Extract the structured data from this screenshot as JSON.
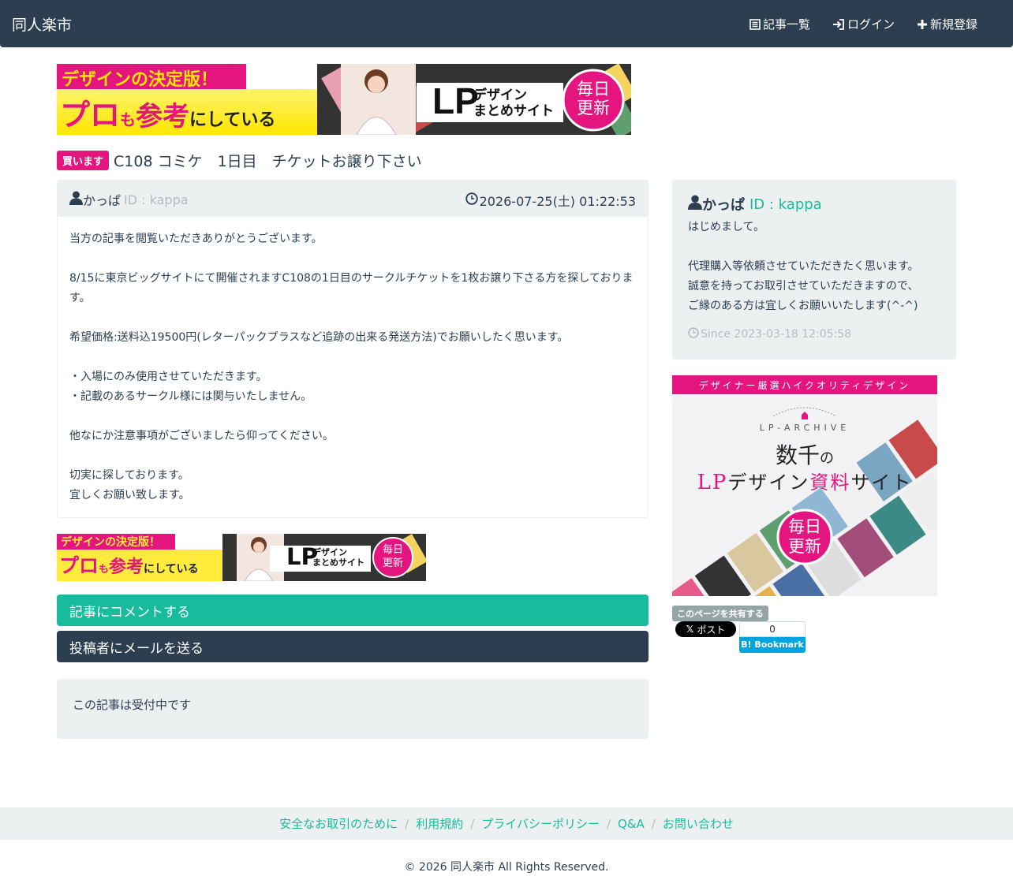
{
  "navbar": {
    "brand": "同人楽市",
    "links": [
      {
        "label": "記事一覧",
        "icon": "list-icon"
      },
      {
        "label": "ログイン",
        "icon": "login-icon"
      },
      {
        "label": "新規登録",
        "icon": "plus-icon"
      }
    ]
  },
  "banners": {
    "top": {
      "headline": "デザインの決定版！",
      "line2a": "プロ",
      "line2b": "も",
      "line2c": "参考",
      "line2d": "にしている",
      "lp": "LP",
      "lp_sub1": "デザイン",
      "lp_sub2": "まとめサイト",
      "daily1": "毎日",
      "daily2": "更新"
    },
    "side": {
      "top": "デザイナー厳選ハイクオリティデザイン",
      "archive": "LP-ARCHIVE",
      "line1a": "数千",
      "line1b": "の",
      "line2a": "LP",
      "line2b": "デザイン",
      "line2c": "資料",
      "line2d": "サイト",
      "daily1": "毎日",
      "daily2": "更新"
    }
  },
  "post": {
    "badge": "買います",
    "title": "C108 コミケ　1日目　チケットお譲り下さい",
    "author": "かっぱ",
    "author_id": "ID : kappa",
    "timestamp": "2026-07-25(土) 01:22:53",
    "body": [
      "当方の記事を閲覧いただきありがとうございます。",
      "",
      "8/15に東京ビッグサイトにて開催されますC108の1日目のサークルチケットを1枚お譲り下さる方を探しております。",
      "",
      "希望価格:送料込19500円(レターパックプラスなど追跡の出来る発送方法)でお願いしたく思います。",
      "",
      "・入場にのみ使用させていただきます。",
      "・記載のあるサークル様には関与いたしません。",
      "",
      "他なにか注意事項がございましたら仰ってください。",
      "",
      "切実に探しております。",
      "宜しくお願い致します。"
    ],
    "status": "この記事は受付中です"
  },
  "buttons": {
    "comment": "記事にコメントする",
    "mail": "投稿者にメールを送る"
  },
  "profile": {
    "name": "かっぱ",
    "id": "ID : kappa",
    "bio": [
      "はじめまして。",
      "",
      "代理購入等依頼させていただきたく思います。",
      "誠意を持ってお取引させていただきますので、",
      "ご縁のある方は宜しくお願いいたします(^-^)"
    ],
    "since": "Since 2023-03-18 12:05:58"
  },
  "share": {
    "label": "このページを共有する",
    "x_post": "ポスト",
    "hatena_count": "0",
    "hatena_label": "Bookmark"
  },
  "footer": {
    "links": [
      "安全なお取引のために",
      "利用規約",
      "プライバシーポリシー",
      "Q&A",
      "お問い合わせ"
    ],
    "copyright": "© 2026 同人楽市 All Rights Reserved."
  },
  "colors": {
    "primary": "#2c3e50",
    "success": "#18bc9c",
    "badge": "#e5157f",
    "light": "#ecf0f1"
  }
}
